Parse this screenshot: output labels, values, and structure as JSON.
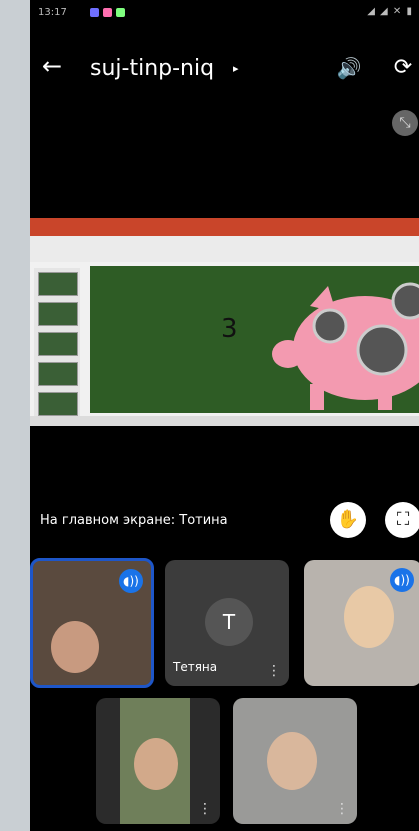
{
  "status": {
    "time": "13:17",
    "app_dot_colors": [
      "#6f6fff",
      "#ff6fb0",
      "#7fff7f"
    ],
    "right_icons": "◢ ◢ ✕ ▮"
  },
  "header": {
    "meeting_code": "suj-tinp-niq",
    "caret": "▸",
    "back_icon": "←",
    "speaker_icon": "🔊",
    "switch_camera_icon": "⟳"
  },
  "presentation": {
    "slide_number": "3",
    "colors": {
      "ribbon": "#c9452a",
      "slide_bg": "#2e5c25",
      "pig": "#f39ab0"
    }
  },
  "pinned": {
    "label": "На главном экране: Тотина",
    "minimize_icon": "⤡",
    "mic_icon": "✋",
    "fullscreen_icon": "⛶"
  },
  "participants": [
    {
      "name": "",
      "speaking": true
    },
    {
      "name": "Тетяна",
      "speaking": false,
      "avatar_letter": "Т"
    },
    {
      "name": "",
      "speaking": true
    },
    {
      "name": "",
      "speaking": false
    },
    {
      "name": "",
      "speaking": false
    }
  ],
  "icons": {
    "more": "⋮",
    "volume": "◖))"
  }
}
